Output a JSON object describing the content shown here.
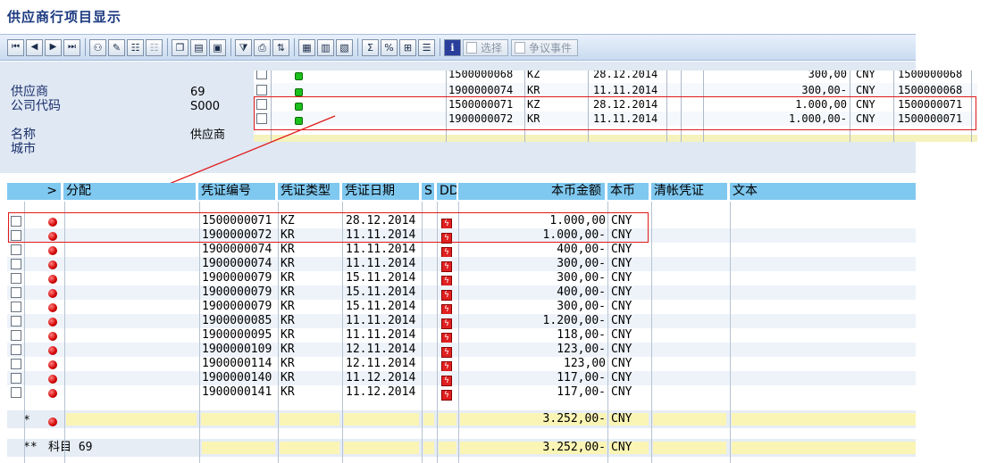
{
  "app": {
    "title": "供应商行项目显示"
  },
  "toolbar": {
    "select_label": "选择",
    "dispute_label": "争议事件"
  },
  "header": {
    "vendor_label": "供应商",
    "vendor_value": "69",
    "company_label": "公司代码",
    "company_value": "S000",
    "name_label": "名称",
    "name_value": "供应商",
    "city_label": "城市"
  },
  "summary_rows": [
    {
      "doc_no": "1500000068",
      "type": "KZ",
      "date": "28.12.2014",
      "amount": "300,00",
      "currency": "CNY",
      "clear_doc": "1500000068"
    },
    {
      "doc_no": "1900000074",
      "type": "KR",
      "date": "11.11.2014",
      "amount": "300,00-",
      "currency": "CNY",
      "clear_doc": "1500000068"
    },
    {
      "doc_no": "1500000071",
      "type": "KZ",
      "date": "28.12.2014",
      "amount": "1.000,00",
      "currency": "CNY",
      "clear_doc": "1500000071"
    },
    {
      "doc_no": "1900000072",
      "type": "KR",
      "date": "11.11.2014",
      "amount": "1.000,00-",
      "currency": "CNY",
      "clear_doc": "1500000071"
    }
  ],
  "columns": {
    "marker": ">",
    "assignment": "分配",
    "doc_no": "凭证编号",
    "doc_type": "凭证类型",
    "doc_date": "凭证日期",
    "s": "S",
    "dd": "DD",
    "amount": "本币金额",
    "currency": "本币",
    "clear_doc": "清帐凭证",
    "text": "文本"
  },
  "rows": [
    {
      "doc_no": "1500000071",
      "type": "KZ",
      "date": "28.12.2014",
      "amount": "1.000,00",
      "currency": "CNY"
    },
    {
      "doc_no": "1900000072",
      "type": "KR",
      "date": "11.11.2014",
      "amount": "1.000,00-",
      "currency": "CNY"
    },
    {
      "doc_no": "1900000074",
      "type": "KR",
      "date": "11.11.2014",
      "amount": "400,00-",
      "currency": "CNY"
    },
    {
      "doc_no": "1900000074",
      "type": "KR",
      "date": "11.11.2014",
      "amount": "300,00-",
      "currency": "CNY"
    },
    {
      "doc_no": "1900000079",
      "type": "KR",
      "date": "15.11.2014",
      "amount": "300,00-",
      "currency": "CNY"
    },
    {
      "doc_no": "1900000079",
      "type": "KR",
      "date": "15.11.2014",
      "amount": "400,00-",
      "currency": "CNY"
    },
    {
      "doc_no": "1900000079",
      "type": "KR",
      "date": "15.11.2014",
      "amount": "300,00-",
      "currency": "CNY"
    },
    {
      "doc_no": "1900000085",
      "type": "KR",
      "date": "11.11.2014",
      "amount": "1.200,00-",
      "currency": "CNY"
    },
    {
      "doc_no": "1900000095",
      "type": "KR",
      "date": "11.11.2014",
      "amount": "118,00-",
      "currency": "CNY"
    },
    {
      "doc_no": "1900000109",
      "type": "KR",
      "date": "12.11.2014",
      "amount": "123,00-",
      "currency": "CNY"
    },
    {
      "doc_no": "1900000114",
      "type": "KR",
      "date": "12.11.2014",
      "amount": "123,00",
      "currency": "CNY"
    },
    {
      "doc_no": "1900000140",
      "type": "KR",
      "date": "11.12.2014",
      "amount": "117,00-",
      "currency": "CNY"
    },
    {
      "doc_no": "1900000141",
      "type": "KR",
      "date": "11.12.2014",
      "amount": "117,00-",
      "currency": "CNY"
    }
  ],
  "subtotal": {
    "marker": "*",
    "amount": "3.252,00-",
    "currency": "CNY"
  },
  "total": {
    "marker": "**",
    "label": "科目 69",
    "amount": "3.252,00-",
    "currency": "CNY"
  },
  "colors": {
    "header_cell": "#7fc8f0",
    "total_cell": "#fbf5b5",
    "status_open": "#d10000",
    "status_cleared": "#1cc01c",
    "highlight_box": "#e01a1a"
  }
}
